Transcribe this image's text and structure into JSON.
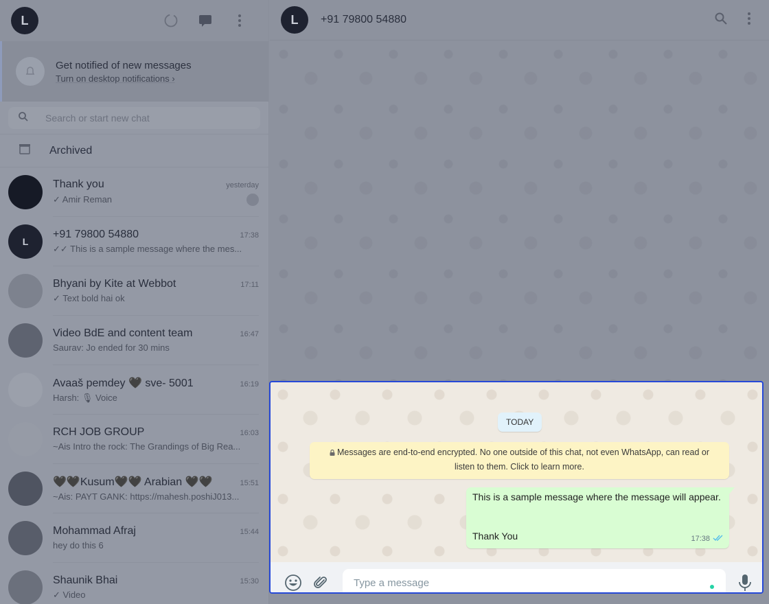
{
  "sidebar": {
    "profile_initial": "L",
    "notification": {
      "title": "Get notified of new messages",
      "link": "Turn on desktop notifications ›"
    },
    "search": {
      "placeholder": "Search or start new chat"
    },
    "archived_label": "Archived",
    "chats": [
      {
        "name": "Thank you",
        "time": "yesterday",
        "message": "✓ Amir Reman",
        "avatar": ""
      },
      {
        "name": "+91 79800 54880",
        "time": "17:38",
        "message": "✓✓ This is a sample message where the mes...",
        "avatar": "L"
      },
      {
        "name": "Bhyani by Kite at Webbot",
        "time": "17:11",
        "message": "✓ Text bold hai ok",
        "avatar": ""
      },
      {
        "name": "Video BdE and content team",
        "time": "16:47",
        "message": "Saurav: Jo ended for 30 mins",
        "avatar": ""
      },
      {
        "name": "Avaaš pemdey 🖤 sve- 5001",
        "time": "16:19",
        "message": "Harsh: 🎙 Voice",
        "avatar": ""
      },
      {
        "name": "RCH JOB GROUP",
        "time": "16:03",
        "message": "~Ais Intro the rock: The Grandings of Big Rea...",
        "avatar": ""
      },
      {
        "name": "🖤🖤Kusum🖤🖤 Arabian 🖤🖤",
        "time": "15:51",
        "message": "~Ais: PAYT GANK: https://mahesh.poshiJ013...",
        "avatar": ""
      },
      {
        "name": "Mohammad Afraj",
        "time": "15:44",
        "message": "hey do this 6",
        "avatar": ""
      },
      {
        "name": "Shaunik Bhai",
        "time": "15:30",
        "message": "✓ Video",
        "avatar": ""
      }
    ]
  },
  "conversation": {
    "contact_name": "+91 79800 54880",
    "avatar_initial": "L",
    "date_chip": "TODAY",
    "encryption_notice": "Messages are end-to-end encrypted. No one outside of this chat, not even WhatsApp, can read or listen to them. Click to learn more.",
    "message": {
      "line1": "This is a sample message where the message will appear.",
      "line2": "Thank You",
      "time": "17:38"
    },
    "composer": {
      "placeholder": "Type a message"
    }
  },
  "colors": {
    "accent": "#25d3a6",
    "outgoing_bubble": "#d9fdd3",
    "highlight_border": "#2548d8"
  }
}
